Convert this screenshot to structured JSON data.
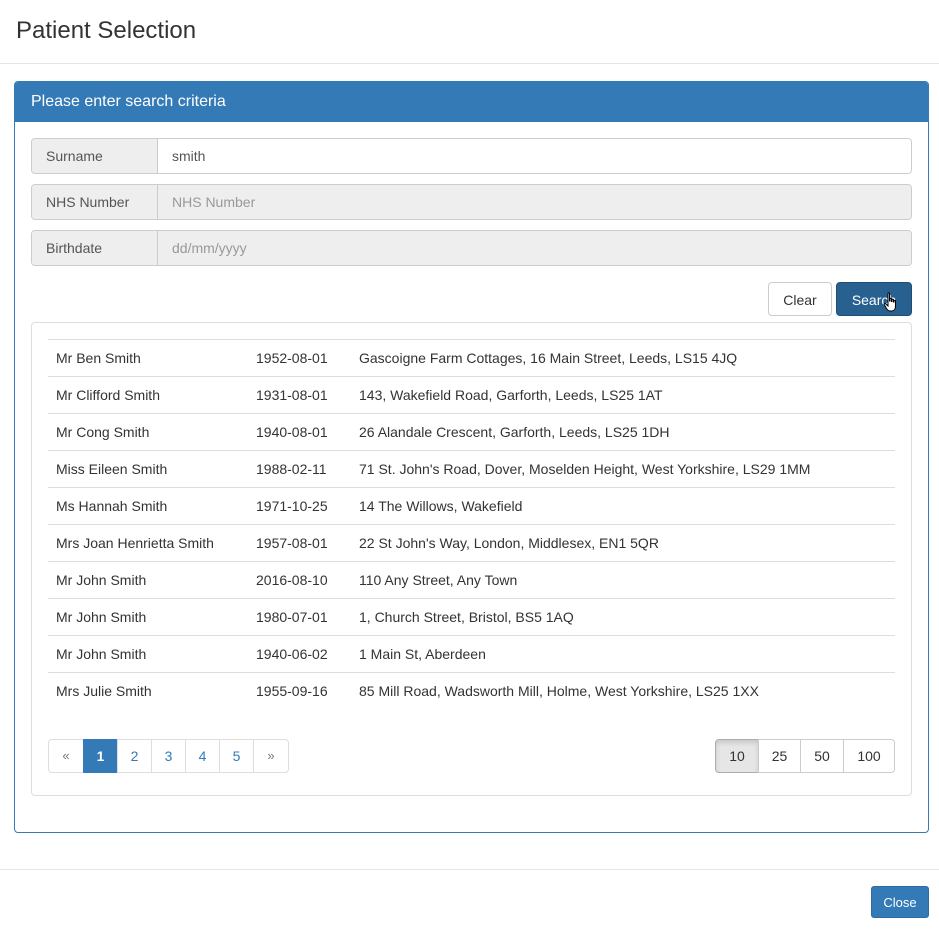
{
  "modal": {
    "title": "Patient Selection",
    "close_label": "Close"
  },
  "search_panel": {
    "heading": "Please enter search criteria",
    "surname": {
      "label": "Surname",
      "value": "smith",
      "placeholder": ""
    },
    "nhs_number": {
      "label": "NHS Number",
      "value": "",
      "placeholder": "NHS Number"
    },
    "birthdate": {
      "label": "Birthdate",
      "value": "",
      "placeholder": "dd/mm/yyyy"
    },
    "clear_label": "Clear",
    "search_label": "Search"
  },
  "results": {
    "rows": [
      {
        "name": "Mr Ben Smith",
        "dob": "1952-08-01",
        "address": "Gascoigne Farm Cottages, 16 Main Street, Leeds, LS15 4JQ"
      },
      {
        "name": "Mr Clifford Smith",
        "dob": "1931-08-01",
        "address": "143, Wakefield Road, Garforth, Leeds, LS25 1AT"
      },
      {
        "name": "Mr Cong Smith",
        "dob": "1940-08-01",
        "address": "26 Alandale Crescent, Garforth, Leeds, LS25 1DH"
      },
      {
        "name": "Miss Eileen Smith",
        "dob": "1988-02-11",
        "address": "71 St. John's Road, Dover, Moselden Height, West Yorkshire, LS29 1MM"
      },
      {
        "name": "Ms Hannah Smith",
        "dob": "1971-10-25",
        "address": "14 The Willows, Wakefield"
      },
      {
        "name": "Mrs Joan Henrietta Smith",
        "dob": "1957-08-01",
        "address": "22 St John's Way, London, Middlesex, EN1 5QR"
      },
      {
        "name": "Mr John Smith",
        "dob": "2016-08-10",
        "address": "110 Any Street, Any Town"
      },
      {
        "name": "Mr John Smith",
        "dob": "1980-07-01",
        "address": "1, Church Street, Bristol, BS5 1AQ"
      },
      {
        "name": "Mr John Smith",
        "dob": "1940-06-02",
        "address": "1 Main St, Aberdeen"
      },
      {
        "name": "Mrs Julie Smith",
        "dob": "1955-09-16",
        "address": "85 Mill Road, Wadsworth Mill, Holme, West Yorkshire, LS25 1XX"
      }
    ],
    "pagination": {
      "prev": "«",
      "pages": [
        "1",
        "2",
        "3",
        "4",
        "5"
      ],
      "next": "»",
      "current": "1"
    },
    "page_sizes": [
      "10",
      "25",
      "50",
      "100"
    ],
    "page_size_selected": "10"
  },
  "colors": {
    "primary": "#337ab7",
    "primary_dark": "#286090",
    "border": "#dddddd"
  },
  "icons": {
    "cursor": "hand-pointer-icon"
  }
}
